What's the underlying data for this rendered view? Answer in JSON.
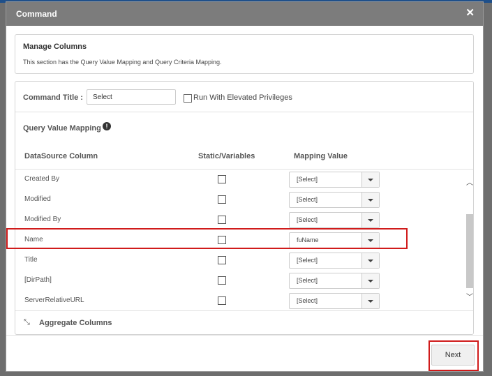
{
  "dialog": {
    "title": "Command",
    "close_icon": "close-icon"
  },
  "manage": {
    "title": "Manage Columns",
    "description": "This section has the Query Value Mapping and Query Criteria Mapping."
  },
  "command": {
    "title_label": "Command Title :",
    "title_value": "Select",
    "elevated_label": "Run With Elevated Privileges"
  },
  "query_mapping": {
    "title": "Query Value Mapping",
    "headers": {
      "datasource": "DataSource Column",
      "static": "Static/Variables",
      "mapping": "Mapping Value"
    },
    "rows": [
      {
        "column": "Created By",
        "value": "[Select]"
      },
      {
        "column": "Modified",
        "value": "[Select]"
      },
      {
        "column": "Modified By",
        "value": "[Select]"
      },
      {
        "column": "Name",
        "value": "fuName"
      },
      {
        "column": "Title",
        "value": "[Select]"
      },
      {
        "column": "[DirPath]",
        "value": "[Select]"
      },
      {
        "column": "ServerRelativeURL",
        "value": "[Select]"
      }
    ]
  },
  "aggregate": {
    "label": "Aggregate Columns"
  },
  "footer": {
    "next_label": "Next"
  },
  "colors": {
    "header_bg": "#7c7c7c",
    "highlight": "#d01b1b"
  }
}
